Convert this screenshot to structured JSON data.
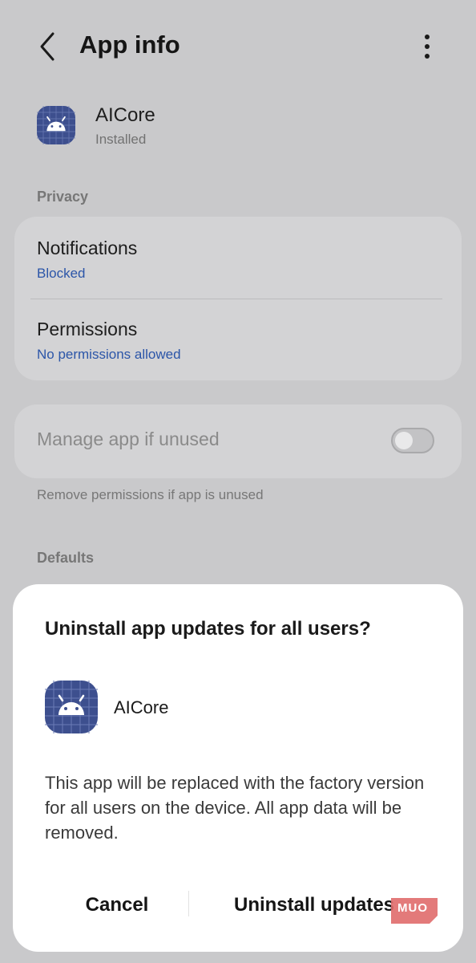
{
  "header": {
    "title": "App info",
    "back_icon": "chevron-left-icon",
    "more_icon": "more-vertical-icon"
  },
  "app": {
    "name": "AICore",
    "status": "Installed",
    "icon": "android-icon",
    "icon_color": "#3d4f8e"
  },
  "privacy": {
    "section_label": "Privacy",
    "items": [
      {
        "title": "Notifications",
        "subtitle": "Blocked"
      },
      {
        "title": "Permissions",
        "subtitle": "No permissions allowed"
      }
    ]
  },
  "manage_unused": {
    "label": "Manage app if unused",
    "enabled": false,
    "helper": "Remove permissions if app is unused"
  },
  "defaults": {
    "section_label": "Defaults"
  },
  "dialog": {
    "title": "Uninstall app updates for all users?",
    "app_name": "AICore",
    "body": "This app will be replaced with the factory version for all users on the device. All app data will be removed.",
    "cancel_label": "Cancel",
    "confirm_label": "Uninstall updates"
  },
  "watermark": {
    "text": "MUO",
    "color": "#e06b6b"
  },
  "colors": {
    "link_blue": "#2b55a8",
    "background": "#c9c9cb"
  }
}
